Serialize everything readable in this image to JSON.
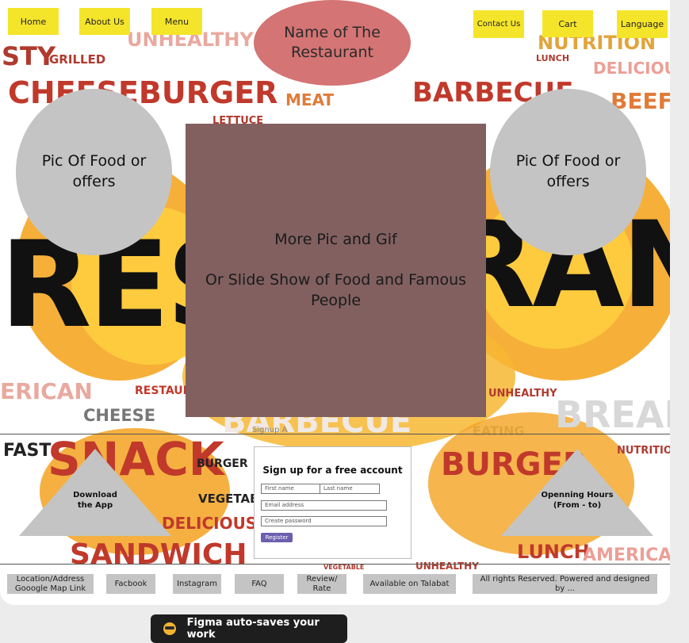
{
  "nav": {
    "home": "Home",
    "about": "About Us",
    "menu": "Menu",
    "contact": "Contact Us",
    "cart": "Cart",
    "language": "Language"
  },
  "restaurant_name": "Name of The Restaurant",
  "promo_left": "Pic Of Food or offers",
  "promo_right": "Pic Of Food or offers",
  "slideshow": {
    "line1": "More Pic and Gif",
    "line2": "Or Slide Show of Food and Famous People"
  },
  "download_app": "Download the App",
  "opening_hours": "Openning Hours (From - to)",
  "signup": {
    "tag": "Signup A",
    "title": "Sign up for a free account",
    "first_name": "First name",
    "last_name": "Last name",
    "email": "Email address",
    "password": "Create password",
    "register": "Register"
  },
  "footer": {
    "location": "Location/Address Gooogle Map Link",
    "facebook": "Facbook",
    "instagram": "Instagram",
    "faq": "FAQ",
    "review": "Review/ Rate",
    "talabat": "Available on Talabat",
    "rights": "All rights Reserved. Powered and designed by ..."
  },
  "background_words": [
    "STY",
    "GRILLED",
    "UNHEALTHY",
    "NUTRITION",
    "DELICIOUS",
    "LUNCH",
    "CHEESEBURGER",
    "MEAT",
    "BARBECUE",
    "BEEF",
    "LETTUCE",
    "RES",
    "RANT",
    "ERICAN",
    "RESTAURA",
    "CHEESE",
    "BARBECUE",
    "EATING",
    "BREAD",
    "UNHEALTHY",
    "FAST",
    "SNACK",
    "BURGER",
    "VEGETABLE",
    "DELICIOUS",
    "BURGER",
    "NUTRITION",
    "SANDWICH",
    "LUNCH",
    "AMERICAN",
    "UNHEALTHY",
    "VEGETABLE"
  ],
  "toast": "Figma auto-saves your work",
  "colors": {
    "nav_yellow": "#f5e52a",
    "name_oval": "#d47474",
    "slideshow": "#826060",
    "placeholder_grey": "#c4c4c4",
    "word_red": "#c0392b",
    "splash_orange": "#f39c12",
    "register_purple": "#6b5fae"
  }
}
